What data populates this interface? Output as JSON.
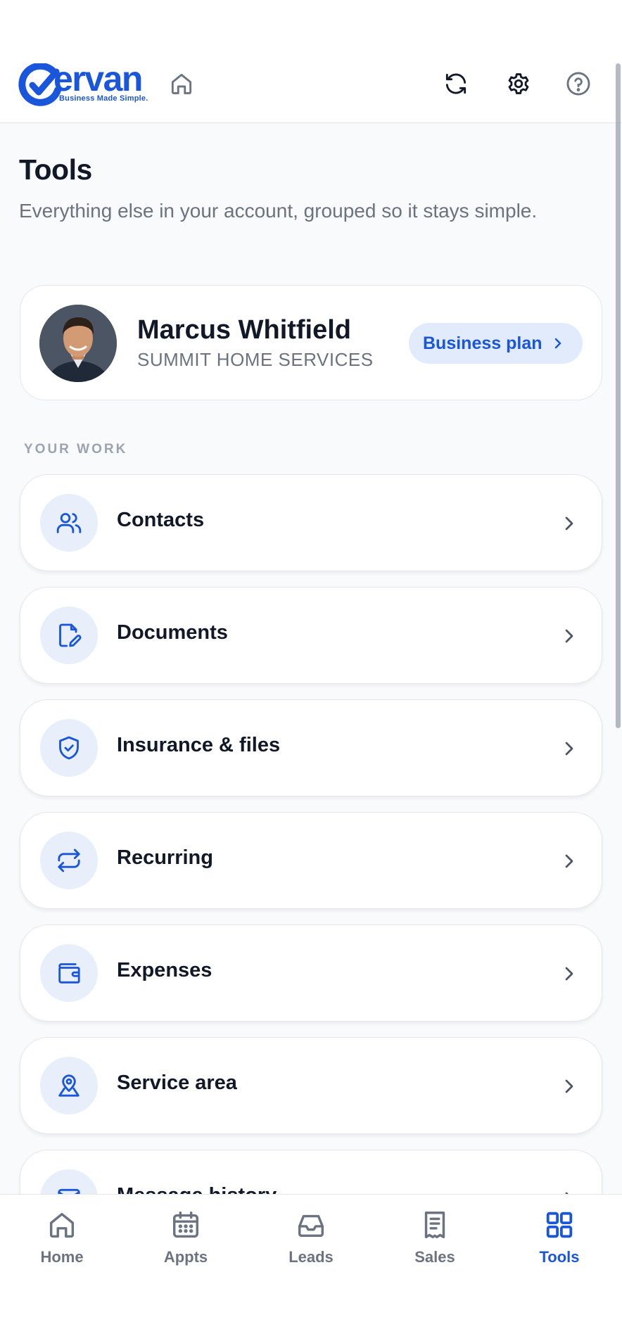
{
  "header": {
    "logo_text": "ervan",
    "logo_tagline": "Business Made Simple.",
    "icons": [
      "home-icon",
      "refresh-icon",
      "settings-icon",
      "help-icon"
    ]
  },
  "page": {
    "title": "Tools",
    "subtitle": "Everything else in your account, grouped so it stays simple."
  },
  "profile": {
    "name": "Marcus Whitfield",
    "company": "SUMMIT HOME SERVICES",
    "plan_label": "Business plan"
  },
  "section": {
    "label": "YOUR WORK"
  },
  "items": [
    {
      "label": "Contacts",
      "icon": "users-icon"
    },
    {
      "label": "Documents",
      "icon": "document-edit-icon"
    },
    {
      "label": "Insurance & files",
      "icon": "shield-check-icon"
    },
    {
      "label": "Recurring",
      "icon": "repeat-icon"
    },
    {
      "label": "Expenses",
      "icon": "wallet-icon"
    },
    {
      "label": "Service area",
      "icon": "map-pin-icon"
    },
    {
      "label": "Message history",
      "icon": "message-icon"
    }
  ],
  "nav": [
    {
      "label": "Home",
      "icon": "home-icon"
    },
    {
      "label": "Appts",
      "icon": "calendar-icon"
    },
    {
      "label": "Leads",
      "icon": "inbox-icon"
    },
    {
      "label": "Sales",
      "icon": "receipt-icon"
    },
    {
      "label": "Tools",
      "icon": "grid-icon",
      "active": true
    }
  ],
  "colors": {
    "accent": "#1a56db",
    "background": "#f8fafc",
    "icon_circle": "#e8eefa",
    "muted_text": "#6b7280"
  }
}
